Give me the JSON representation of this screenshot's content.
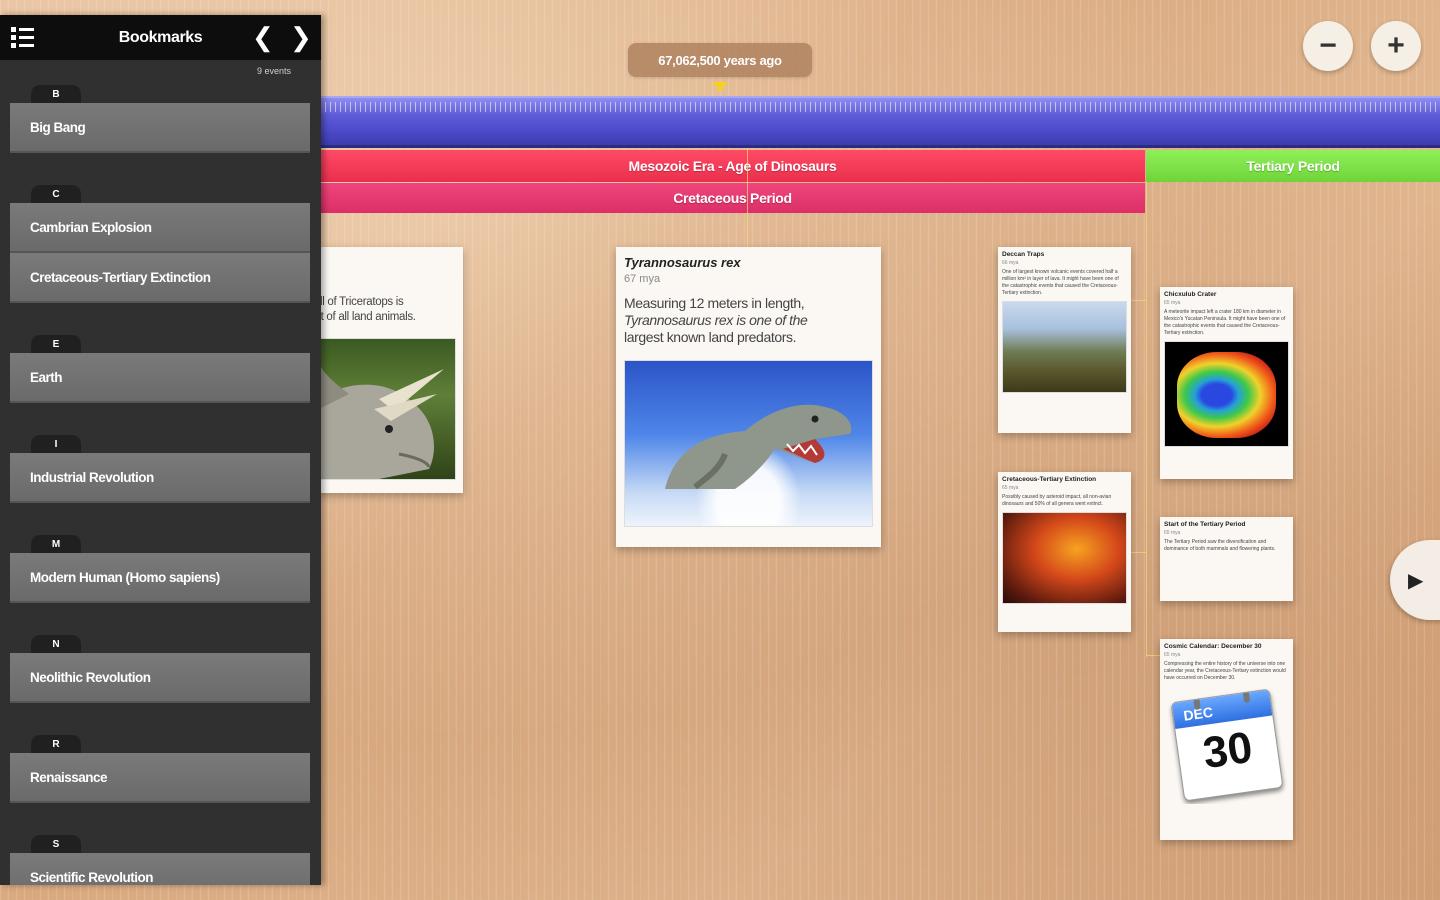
{
  "timeline": {
    "readout": "67,062,500 years ago",
    "zoom_out_label": "−",
    "zoom_in_label": "+"
  },
  "bands": {
    "mesozoic": "Mesozoic Era - Age of Dinosaurs",
    "cretaceous": "Cretaceous Period",
    "tertiary": "Tertiary Period"
  },
  "cards": {
    "trex": {
      "title": "Tyrannosaurus rex",
      "subtitle": "67 mya",
      "body_line1": "Measuring 12 meters in length,",
      "body_line2": "Tyrannosaurus rex is one of the",
      "body_line3": "largest known land predators."
    },
    "triceratops": {
      "body_line1": "skull of Triceratops is",
      "body_line2": "gest of all land animals."
    },
    "deccan": {
      "title": "Deccan Traps",
      "subtitle": "66 mya",
      "body": "One of largest known volcanic events covered half a million km² in layer of lava. It might have been one of the catastrophic events that caused the Cretaceous-Tertiary extinction."
    },
    "kt": {
      "title": "Cretaceous-Tertiary Extinction",
      "subtitle": "65 mya",
      "body": "Possibly caused by asteroid impact, all non-avian dinosaurs and 50% of all genera went extinct."
    },
    "chicxulub": {
      "title": "Chicxulub Crater",
      "subtitle": "65 mya",
      "body": "A meteorite impact left a crater 180 km in diameter in Mexico's Yucatan Peninsula. It might have been one of the catastrophic events that caused the Cretaceous-Tertiary extinction."
    },
    "tertiary_start": {
      "title": "Start of the Tertiary Period",
      "subtitle": "65 mya",
      "body": "The Tertiary Period saw the diversification and dominance of both mammals and flowering plants."
    },
    "cosmic": {
      "title": "Cosmic Calendar: December 30",
      "subtitle": "65 mya",
      "body": "Compressing the entire history of the universe into one calendar year, the Cretaceous-Tertiary extinction would have occurred on December 30.",
      "cal_month": "DEC",
      "cal_day": "30"
    }
  },
  "sidebar": {
    "title": "Bookmarks",
    "count": "9 events",
    "groups": [
      {
        "letter": "B",
        "items": [
          "Big Bang"
        ]
      },
      {
        "letter": "C",
        "items": [
          "Cambrian Explosion",
          "Cretaceous-Tertiary Extinction"
        ]
      },
      {
        "letter": "E",
        "items": [
          "Earth"
        ]
      },
      {
        "letter": "I",
        "items": [
          "Industrial Revolution"
        ]
      },
      {
        "letter": "M",
        "items": [
          "Modern Human (Homo sapiens)"
        ]
      },
      {
        "letter": "N",
        "items": [
          "Neolithic Revolution"
        ]
      },
      {
        "letter": "R",
        "items": [
          "Renaissance"
        ]
      },
      {
        "letter": "S",
        "items": [
          "Scientific Revolution"
        ]
      }
    ]
  },
  "colors": {
    "ribbon": "#4b48c8",
    "mesozoic": "#ea2f4c",
    "cretaceous": "#dc2f68",
    "tertiary": "#6fd43a",
    "sidebar_bg": "#303030"
  },
  "icons": {
    "list": "list-icon",
    "prev": "chevron-left-icon",
    "next": "chevron-right-icon",
    "zoom_out": "minus-icon",
    "zoom_in": "plus-icon",
    "forward": "triangle-right-icon"
  }
}
